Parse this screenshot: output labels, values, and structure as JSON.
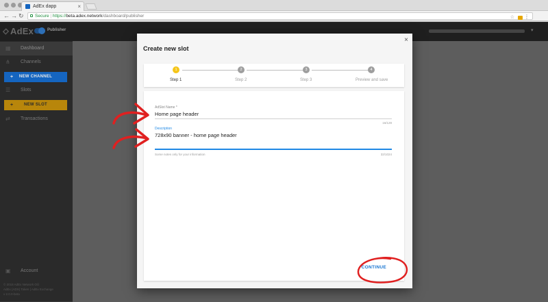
{
  "browser": {
    "tab_title": "AdEx dapp",
    "secure_label": "Secure",
    "url_scheme": "https://",
    "url_host": "beta.adex.network",
    "url_path": "/dashboard/publisher"
  },
  "appbar": {
    "logo": "AdEx",
    "role_label": "Publisher"
  },
  "sidebar": {
    "items": [
      {
        "label": "Dashboard",
        "icon": "dashboard-icon"
      },
      {
        "label": "Channels",
        "icon": "channels-icon"
      },
      {
        "label": "Slots",
        "icon": "slots-icon"
      },
      {
        "label": "Transactions",
        "icon": "transactions-icon"
      },
      {
        "label": "Account",
        "icon": "account-icon"
      }
    ],
    "new_channel_label": "NEW CHANNEL",
    "new_slot_label": "NEW SLOT",
    "footer": [
      "© 2018 AdEx Network OÜ",
      "AdEx (ADX) Token | AdEx Exchange",
      "v 2.0.0-beta"
    ]
  },
  "modal": {
    "title": "Create new slot",
    "steps": [
      {
        "label": "Step 1",
        "number": "1",
        "active": true
      },
      {
        "label": "Step 2",
        "number": "2",
        "active": false
      },
      {
        "label": "Step 3",
        "number": "3",
        "active": false
      },
      {
        "label": "Preview and save",
        "number": "4",
        "active": false
      }
    ],
    "name_field": {
      "label": "AdSlot Name *",
      "value": "Home page header",
      "counter": "16/128"
    },
    "description_field": {
      "label": "Description",
      "value": "728x90 banner - home page header",
      "hint": "Some notes only for your information",
      "counter": "32/1024"
    },
    "continue_label": "CONTINUE"
  },
  "colors": {
    "accent_blue": "#1e88e5",
    "step_active": "#f5c518",
    "annotation_red": "#e02020"
  }
}
